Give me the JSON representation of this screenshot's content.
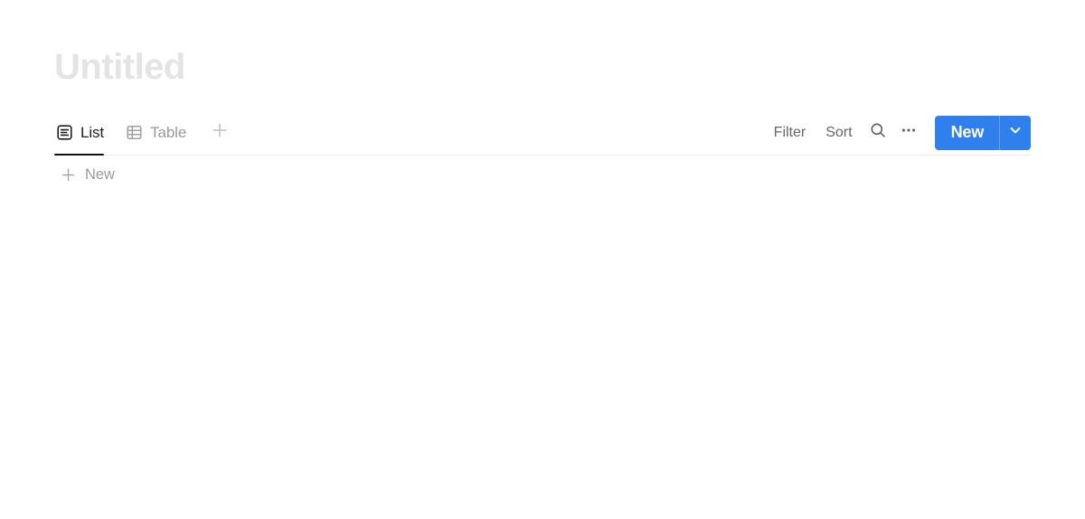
{
  "page": {
    "title": "Untitled",
    "title_is_placeholder": true
  },
  "colors": {
    "accent": "#2f80ed",
    "title_placeholder": "#e4e4e4",
    "active_tab_text": "#1f1f1f",
    "inactive_tab_text": "#9a9a9a",
    "toolbar_text": "#676767",
    "muted_text": "#9b9b9b",
    "divider": "#ededed",
    "active_underline": "#121212"
  },
  "viewbar": {
    "tabs": [
      {
        "label": "List",
        "icon": "list-view-icon",
        "active": true
      },
      {
        "label": "Table",
        "icon": "table-view-icon",
        "active": false
      }
    ],
    "add_view_icon": "plus-icon",
    "tools": [
      {
        "label": "Filter",
        "type": "text",
        "name": "filter-button"
      },
      {
        "label": "Sort",
        "type": "text",
        "name": "sort-button"
      },
      {
        "label": "",
        "type": "icon",
        "icon": "search-icon",
        "name": "search-button"
      },
      {
        "label": "",
        "type": "icon",
        "icon": "ellipsis-icon",
        "name": "more-options-button"
      }
    ],
    "new_button": {
      "label": "New",
      "caret_icon": "chevron-down-icon"
    }
  },
  "list": {
    "items": [],
    "new_row": {
      "label": "New",
      "icon": "plus-icon"
    }
  }
}
